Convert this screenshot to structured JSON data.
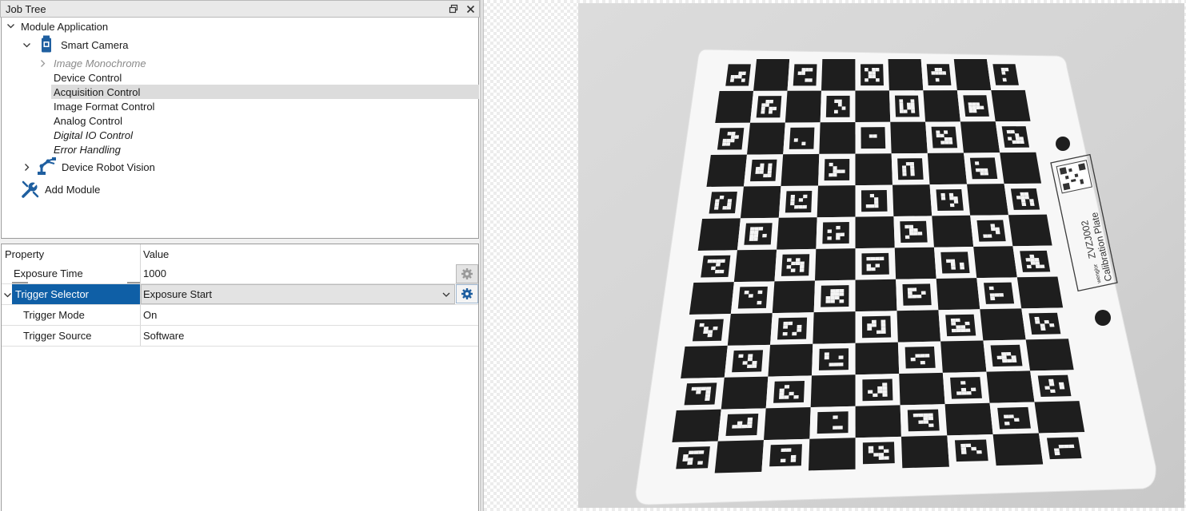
{
  "job_tree": {
    "title": "Job Tree",
    "items": [
      {
        "label": "Module Application"
      },
      {
        "label": "Smart Camera"
      },
      {
        "label": "Image Monochrome"
      },
      {
        "label": "Device Control"
      },
      {
        "label": "Acquisition Control"
      },
      {
        "label": "Image Format Control"
      },
      {
        "label": "Analog Control"
      },
      {
        "label": "Digital IO Control"
      },
      {
        "label": "Error Handling"
      },
      {
        "label": "Device Robot Vision"
      },
      {
        "label": "Add Module"
      }
    ]
  },
  "properties": {
    "headers": {
      "property": "Property",
      "value": "Value"
    },
    "rows": [
      {
        "name": "Exposure Time",
        "value": "1000"
      },
      {
        "name": "Trigger Selector",
        "value": "Exposure Start"
      },
      {
        "name": "Trigger Mode",
        "value": "On"
      },
      {
        "name": "Trigger Source",
        "value": "Software"
      }
    ]
  },
  "image": {
    "plate_brand": "wenglor",
    "plate_model": "ZVZJ002",
    "plate_label": "Calibration Plate"
  },
  "colors": {
    "selection_blue": "#0f5fa6",
    "icon_blue": "#1f5fa0"
  }
}
